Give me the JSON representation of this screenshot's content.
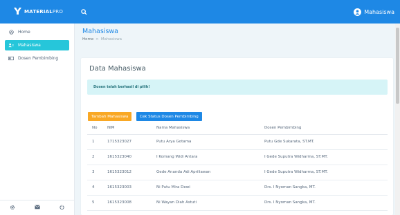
{
  "app": {
    "name_bold": "MATERIAL",
    "name_light": "PRO"
  },
  "topbar": {
    "user_name": "Mahasiswa"
  },
  "sidebar": {
    "items": [
      {
        "label": "Home",
        "icon": "home-icon"
      },
      {
        "label": "Mahasiswa",
        "icon": "user-icon"
      },
      {
        "label": "Dosen Pembimbing",
        "icon": "card-icon"
      }
    ],
    "footer_icons": [
      "gear-icon",
      "mail-icon",
      "power-icon"
    ]
  },
  "page": {
    "title": "Mahasiswa",
    "breadcrumb": {
      "home": "Home",
      "separator": ">",
      "current": "Mahasiswa"
    }
  },
  "card": {
    "title": "Data Mahasiswa",
    "alert": "Dosen telah berhasil di pilih!",
    "buttons": {
      "add": "Tambah Mahasiswa",
      "check": "Cek Status Dosen Pembimbing"
    }
  },
  "table": {
    "headers": [
      "No",
      "NIM",
      "Nama Mahasiswa",
      "Dosen Pembimbing"
    ],
    "rows": [
      [
        "1",
        "1715323027",
        "Putu Arya Gotama",
        "Putu Gde Sukarata, ST.MT."
      ],
      [
        "2",
        "1615323040",
        "I Komang Widi Antara",
        "I Gede Suputra Widharma, ST.MT."
      ],
      [
        "3",
        "1615323012",
        "Gede Ananda Adi Apriliawan",
        "I Gede Suputra Widharma, ST.MT."
      ],
      [
        "4",
        "1615323003",
        "Ni Putu Mira Dewi",
        "Drs. I Nyoman Sangka, MT."
      ],
      [
        "5",
        "1615323008",
        "Ni Wayan Diah Astuti",
        "Drs. I Nyoman Sangka, MT."
      ]
    ]
  },
  "colors": {
    "primary": "#1e88e5",
    "active": "#26c6da",
    "warning": "#f9a825",
    "alert_bg": "#d6f4f7"
  }
}
